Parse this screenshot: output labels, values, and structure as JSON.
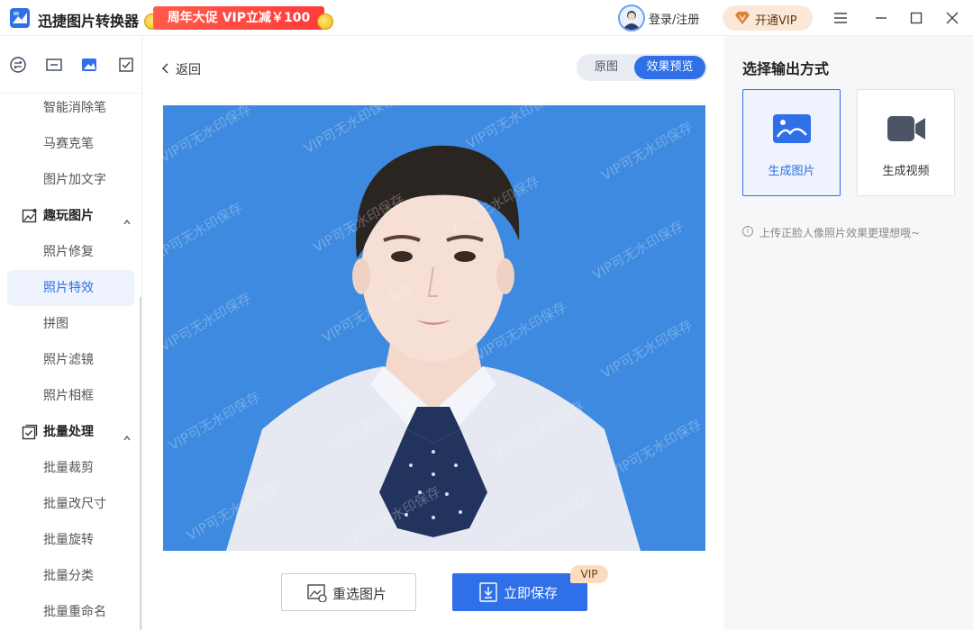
{
  "app": {
    "name": "迅捷图片转换器",
    "promo": "周年大促 VIP立减￥100",
    "login": "登录/注册",
    "vip_button": "开通VIP"
  },
  "sidebar": {
    "items": [
      {
        "label": "智能消除笔"
      },
      {
        "label": "马赛克笔"
      },
      {
        "label": "图片加文字"
      },
      {
        "label": "趣玩图片",
        "group": true
      },
      {
        "label": "照片修复"
      },
      {
        "label": "照片特效",
        "active": true
      },
      {
        "label": "拼图"
      },
      {
        "label": "照片滤镜"
      },
      {
        "label": "照片相框"
      },
      {
        "label": "批量处理",
        "group": true
      },
      {
        "label": "批量裁剪"
      },
      {
        "label": "批量改尺寸"
      },
      {
        "label": "批量旋转"
      },
      {
        "label": "批量分类"
      },
      {
        "label": "批量重命名"
      }
    ]
  },
  "main": {
    "back_label": "返回",
    "toggle": {
      "original": "原图",
      "preview": "效果预览"
    },
    "watermark": "VIP可无水印保存",
    "reselect_label": "重选图片",
    "save_label": "立即保存",
    "vip_tag": "VIP"
  },
  "right_panel": {
    "title": "选择输出方式",
    "option_image": "生成图片",
    "option_video": "生成视频",
    "hint": "上传正脸人像照片效果更理想哦~"
  },
  "colors": {
    "accent": "#2f6fe8",
    "promo_red": "#ff3b3b",
    "preview_bg": "#3d8ae0",
    "vip_bg": "#fde8d7"
  }
}
